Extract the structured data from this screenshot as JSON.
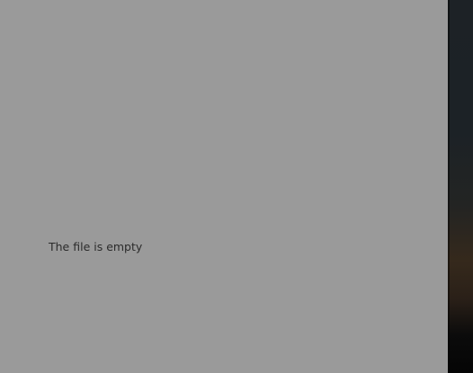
{
  "viewer": {
    "empty_message": "The file is empty"
  },
  "colors": {
    "pane_background": "#9a9a9a",
    "message_text": "#2b2b2b"
  }
}
